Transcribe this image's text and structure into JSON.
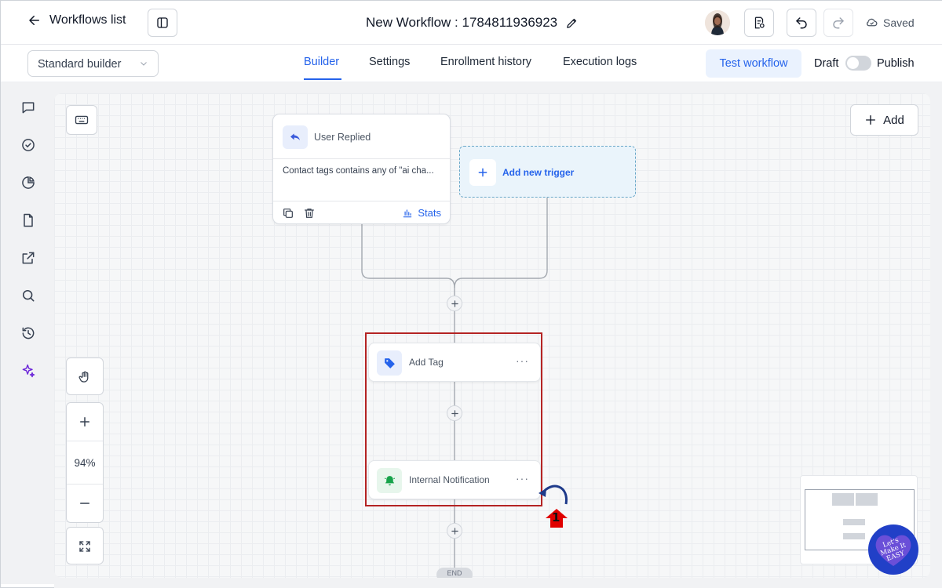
{
  "header": {
    "back_label": "Workflows list",
    "workflow_title": "New Workflow : 1784811936923",
    "save_status": "Saved"
  },
  "toolbar": {
    "builder_mode": "Standard builder",
    "tabs": [
      {
        "label": "Builder",
        "active": true
      },
      {
        "label": "Settings",
        "active": false
      },
      {
        "label": "Enrollment history",
        "active": false
      },
      {
        "label": "Execution logs",
        "active": false
      }
    ],
    "test_label": "Test workflow",
    "draft_label": "Draft",
    "publish_label": "Publish",
    "publish_enabled": false
  },
  "sidebar": {
    "icons": [
      "chat-icon",
      "check-circle-icon",
      "pie-chart-icon",
      "file-icon",
      "external-link-icon",
      "search-icon",
      "history-icon",
      "sparkle-icon"
    ]
  },
  "canvas": {
    "add_label": "Add",
    "zoom": "94%",
    "trigger": {
      "title": "User Replied",
      "condition": "Contact tags contains any of \"ai cha...",
      "stats_label": "Stats"
    },
    "new_trigger_label": "Add new trigger",
    "actions": [
      {
        "label": "Add Tag",
        "icon": "tag-icon",
        "color": "#2563eb"
      },
      {
        "label": "Internal Notification",
        "icon": "bell-icon",
        "color": "#16a34a"
      }
    ],
    "end_label": "END",
    "annotation_number": "1",
    "watermark_text": "Let's Make It EASY"
  },
  "colors": {
    "accent": "#2563eb",
    "highlight": "#b42323",
    "annotation_arrow": "#e00000"
  }
}
